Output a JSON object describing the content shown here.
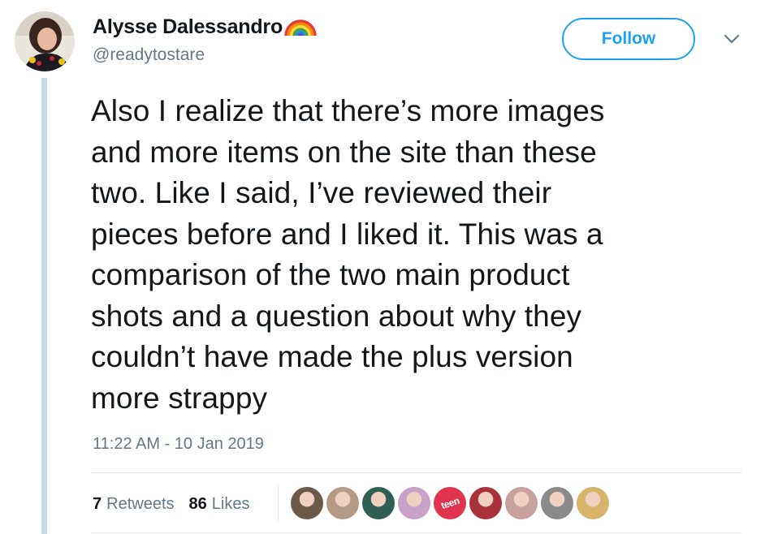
{
  "user": {
    "display_name": "Alysse Dalessandro",
    "handle": "@readytostare",
    "avatar": "profile-photo"
  },
  "header": {
    "follow_label": "Follow",
    "caret_icon": "chevron-down-icon"
  },
  "tweet": {
    "lines": [
      "Also I realize that there’s more images",
      "and more items on the site than these",
      "two. Like I said, I’ve reviewed their",
      "pieces before and I liked it. This was a",
      "comparison of the two main product",
      "shots and a question about why they",
      "couldn’t have made the plus version",
      "more strappy"
    ],
    "timestamp": "11:22 AM - 10 Jan 2019"
  },
  "stats": {
    "retweets_count": "7",
    "retweets_label": "Retweets",
    "likes_count": "86",
    "likes_label": "Likes"
  },
  "likers": [
    {
      "name": "liker-avatar-1",
      "color": "#6b5a4a"
    },
    {
      "name": "liker-avatar-2",
      "color": "#b59a86"
    },
    {
      "name": "liker-avatar-3",
      "color": "#2f5e52"
    },
    {
      "name": "liker-avatar-4",
      "color": "#c8a0c8"
    },
    {
      "name": "liker-avatar-5",
      "color": "#e0344e",
      "text": "teen"
    },
    {
      "name": "liker-avatar-6",
      "color": "#a8323a"
    },
    {
      "name": "liker-avatar-7",
      "color": "#c9a0a0"
    },
    {
      "name": "liker-avatar-8",
      "color": "#8a8a8a"
    },
    {
      "name": "liker-avatar-9",
      "color": "#d8b46a"
    }
  ],
  "colors": {
    "accent": "#1da1f2",
    "text": "#14171a",
    "muted": "#657786",
    "thread_line": "#c4dcec"
  }
}
